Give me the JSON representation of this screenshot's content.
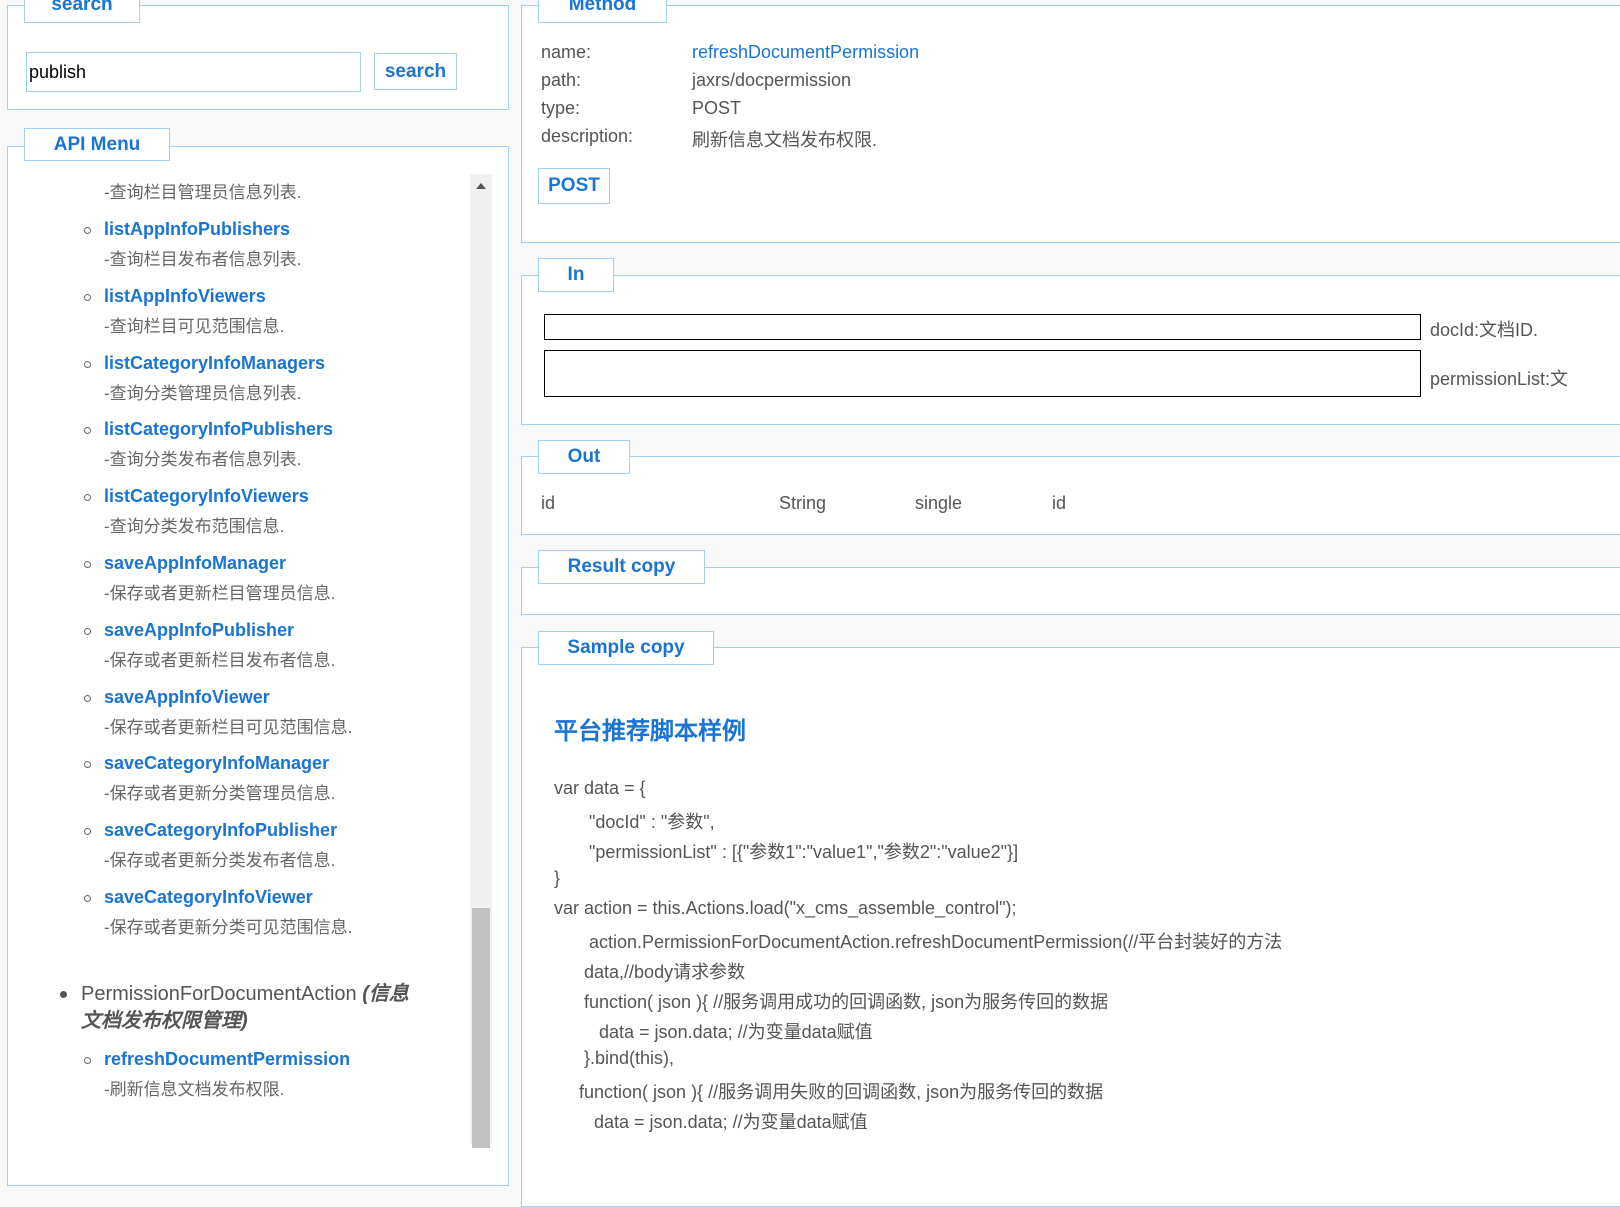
{
  "search": {
    "legend": "search",
    "input_value": "publish",
    "button_label": "search"
  },
  "api_menu": {
    "legend": "API Menu",
    "top_desc": "-查询栏目管理员信息列表.",
    "items": [
      {
        "name": "listAppInfoPublishers",
        "desc": "-查询栏目发布者信息列表."
      },
      {
        "name": "listAppInfoViewers",
        "desc": "-查询栏目可见范围信息."
      },
      {
        "name": "listCategoryInfoManagers",
        "desc": "-查询分类管理员信息列表."
      },
      {
        "name": "listCategoryInfoPublishers",
        "desc": "-查询分类发布者信息列表."
      },
      {
        "name": "listCategoryInfoViewers",
        "desc": "-查询分类发布范围信息."
      },
      {
        "name": "saveAppInfoManager",
        "desc": "-保存或者更新栏目管理员信息."
      },
      {
        "name": "saveAppInfoPublisher",
        "desc": "-保存或者更新栏目发布者信息."
      },
      {
        "name": "saveAppInfoViewer",
        "desc": "-保存或者更新栏目可见范围信息."
      },
      {
        "name": "saveCategoryInfoManager",
        "desc": "-保存或者更新分类管理员信息."
      },
      {
        "name": "saveCategoryInfoPublisher",
        "desc": "-保存或者更新分类发布者信息."
      },
      {
        "name": "saveCategoryInfoViewer",
        "desc": "-保存或者更新分类可见范围信息."
      }
    ],
    "group": {
      "name": "PermissionForDocumentAction",
      "note_line1": "(信息",
      "note_line2": "文档发布权限管理)"
    },
    "group_items": [
      {
        "name": "refreshDocumentPermission",
        "desc": "-刷新信息文档发布权限."
      }
    ]
  },
  "method": {
    "legend": "Method",
    "rows": [
      {
        "label": "name:",
        "value": "refreshDocumentPermission"
      },
      {
        "label": "path:",
        "value": "jaxrs/docpermission"
      },
      {
        "label": "type:",
        "value": "POST"
      },
      {
        "label": "description:",
        "value": "刷新信息文档发布权限."
      }
    ],
    "button_label": "POST"
  },
  "in": {
    "legend": "In",
    "params": [
      {
        "label": "docId:文档ID."
      },
      {
        "label": "permissionList:文"
      }
    ]
  },
  "out": {
    "legend": "Out",
    "row": [
      "id",
      "String",
      "single",
      "id"
    ]
  },
  "result": {
    "legend": "Result copy"
  },
  "sample": {
    "legend": "Sample copy",
    "heading": "平台推荐脚本样例",
    "lines": [
      "var data = {",
      "       \"docId\" : \"参数\",",
      "       \"permissionList\" : [{\"参数1\":\"value1\",\"参数2\":\"value2\"}]",
      "}",
      "var action = this.Actions.load(\"x_cms_assemble_control\");",
      "       action.PermissionForDocumentAction.refreshDocumentPermission(//平台封装好的方法",
      "      data,//body请求参数",
      "      function( json ){ //服务调用成功的回调函数, json为服务传回的数据",
      "         data = json.data; //为变量data赋值",
      "      }.bind(this),",
      "     function( json ){ //服务调用失败的回调函数, json为服务传回的数据",
      "        data = json.data; //为变量data赋值"
    ]
  }
}
